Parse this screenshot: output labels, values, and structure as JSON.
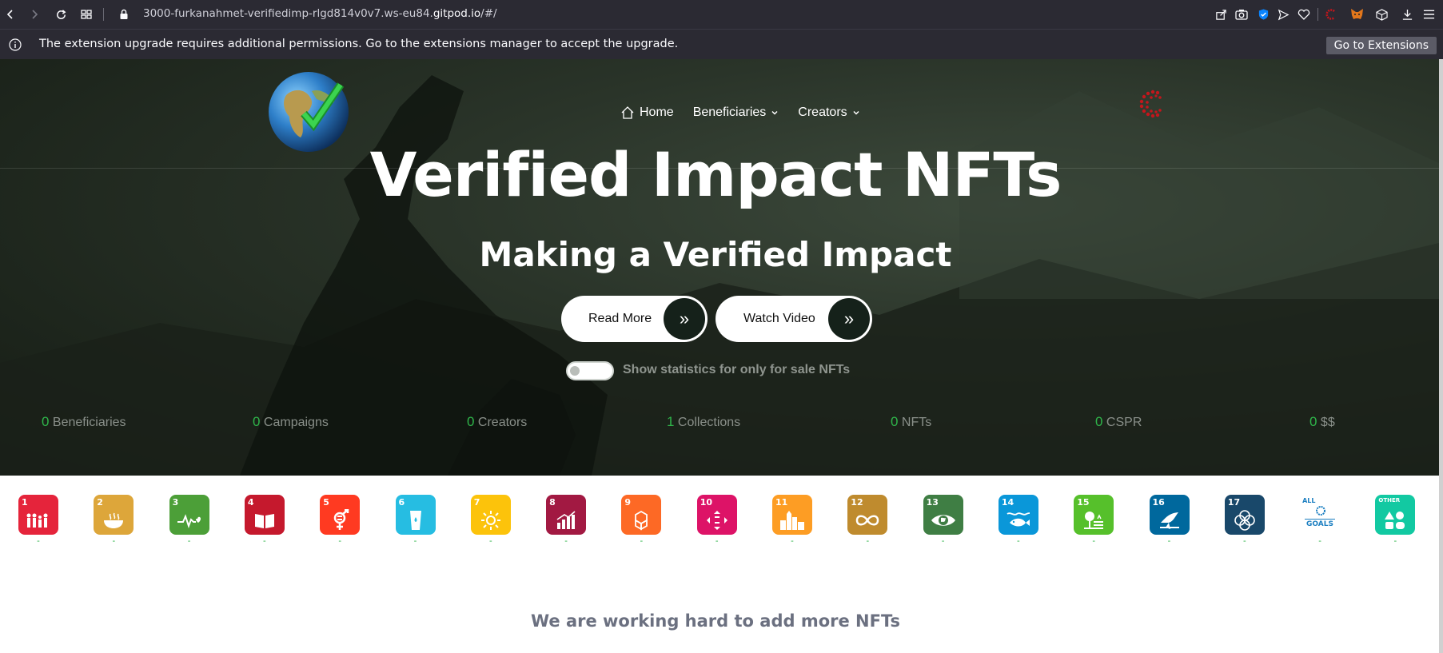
{
  "browser": {
    "url_prefix": "3000-furkanahmet-verifiedimp-rlgd814v0v7.ws-eu84.",
    "url_domain": "gitpod.io",
    "url_suffix": "/#/"
  },
  "notification": {
    "message": "The extension upgrade requires additional permissions. Go to the extensions manager to accept the upgrade.",
    "button": "Go to Extensions"
  },
  "nav": {
    "home": "Home",
    "beneficiaries": "Beneficiaries",
    "creators": "Creators"
  },
  "hero": {
    "title": "Verified Impact NFTs",
    "subtitle": "Making a Verified Impact",
    "read_more": "Read More",
    "watch_video": "Watch Video",
    "toggle_label": "Show statistics for only for sale NFTs"
  },
  "stats": [
    {
      "value": "0",
      "label": "Beneficiaries"
    },
    {
      "value": "0",
      "label": "Campaigns"
    },
    {
      "value": "0",
      "label": "Creators"
    },
    {
      "value": "1",
      "label": "Collections"
    },
    {
      "value": "0",
      "label": "NFTs"
    },
    {
      "value": "0",
      "label": "CSPR"
    },
    {
      "value": "0",
      "label": "$$"
    }
  ],
  "sdgs": [
    {
      "num": "1",
      "color": "#e5243b",
      "count": "-"
    },
    {
      "num": "2",
      "color": "#dda63a",
      "count": "-"
    },
    {
      "num": "3",
      "color": "#4c9f38",
      "count": "-"
    },
    {
      "num": "4",
      "color": "#c5192d",
      "count": "-"
    },
    {
      "num": "5",
      "color": "#ff3a21",
      "count": "-"
    },
    {
      "num": "6",
      "color": "#26bde2",
      "count": "-"
    },
    {
      "num": "7",
      "color": "#fcc30b",
      "count": "-"
    },
    {
      "num": "8",
      "color": "#a21942",
      "count": "-"
    },
    {
      "num": "9",
      "color": "#fd6925",
      "count": "-"
    },
    {
      "num": "10",
      "color": "#dd1367",
      "count": "-"
    },
    {
      "num": "11",
      "color": "#fd9d24",
      "count": "-"
    },
    {
      "num": "12",
      "color": "#bf8b2e",
      "count": "-"
    },
    {
      "num": "13",
      "color": "#3f7e44",
      "count": "-"
    },
    {
      "num": "14",
      "color": "#0a97d9",
      "count": "-"
    },
    {
      "num": "15",
      "color": "#56c02b",
      "count": "-"
    },
    {
      "num": "16",
      "color": "#00689d",
      "count": "-"
    },
    {
      "num": "17",
      "color": "#19486a",
      "count": "-"
    },
    {
      "num": "ALL",
      "color": "#ffffff",
      "count": "-"
    },
    {
      "num": "OTHER",
      "color": "#12c9a2",
      "count": "-"
    }
  ],
  "footer": {
    "message": "We are working hard to add more NFTs"
  }
}
